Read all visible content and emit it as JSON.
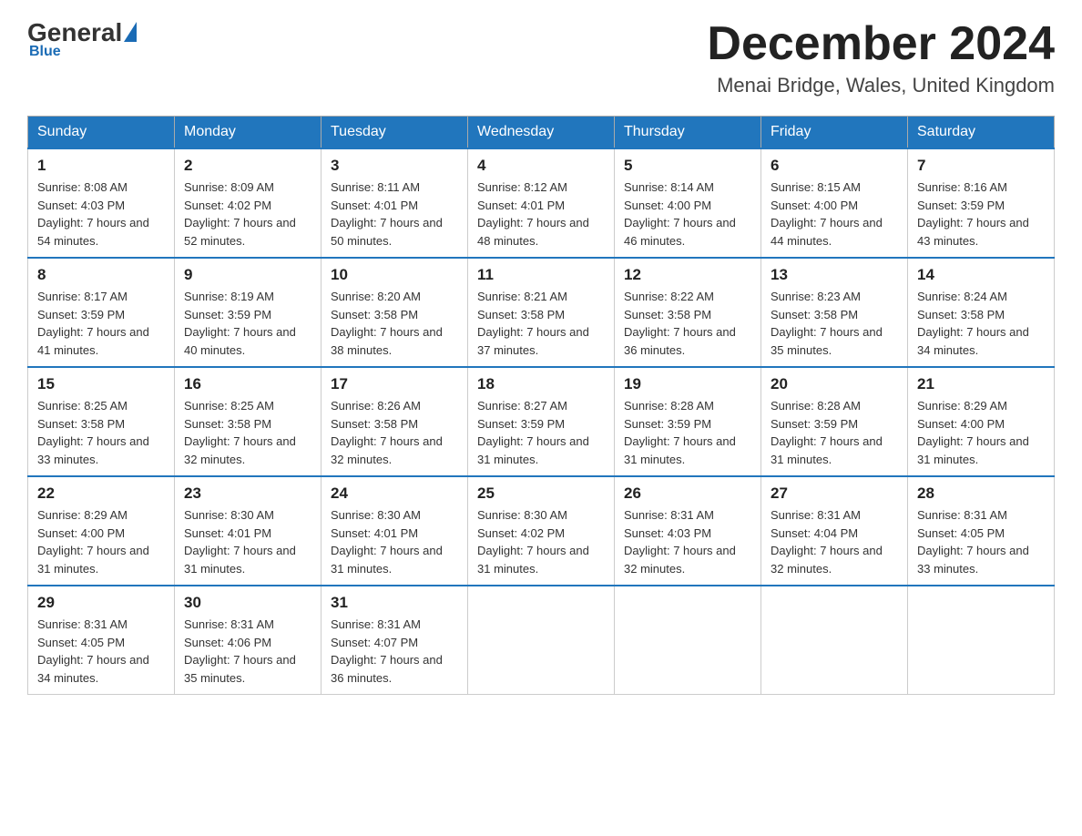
{
  "header": {
    "logo_general": "General",
    "logo_blue": "Blue",
    "month_title": "December 2024",
    "location": "Menai Bridge, Wales, United Kingdom"
  },
  "weekdays": [
    "Sunday",
    "Monday",
    "Tuesday",
    "Wednesday",
    "Thursday",
    "Friday",
    "Saturday"
  ],
  "weeks": [
    [
      {
        "day": "1",
        "sunrise": "8:08 AM",
        "sunset": "4:03 PM",
        "daylight": "7 hours and 54 minutes."
      },
      {
        "day": "2",
        "sunrise": "8:09 AM",
        "sunset": "4:02 PM",
        "daylight": "7 hours and 52 minutes."
      },
      {
        "day": "3",
        "sunrise": "8:11 AM",
        "sunset": "4:01 PM",
        "daylight": "7 hours and 50 minutes."
      },
      {
        "day": "4",
        "sunrise": "8:12 AM",
        "sunset": "4:01 PM",
        "daylight": "7 hours and 48 minutes."
      },
      {
        "day": "5",
        "sunrise": "8:14 AM",
        "sunset": "4:00 PM",
        "daylight": "7 hours and 46 minutes."
      },
      {
        "day": "6",
        "sunrise": "8:15 AM",
        "sunset": "4:00 PM",
        "daylight": "7 hours and 44 minutes."
      },
      {
        "day": "7",
        "sunrise": "8:16 AM",
        "sunset": "3:59 PM",
        "daylight": "7 hours and 43 minutes."
      }
    ],
    [
      {
        "day": "8",
        "sunrise": "8:17 AM",
        "sunset": "3:59 PM",
        "daylight": "7 hours and 41 minutes."
      },
      {
        "day": "9",
        "sunrise": "8:19 AM",
        "sunset": "3:59 PM",
        "daylight": "7 hours and 40 minutes."
      },
      {
        "day": "10",
        "sunrise": "8:20 AM",
        "sunset": "3:58 PM",
        "daylight": "7 hours and 38 minutes."
      },
      {
        "day": "11",
        "sunrise": "8:21 AM",
        "sunset": "3:58 PM",
        "daylight": "7 hours and 37 minutes."
      },
      {
        "day": "12",
        "sunrise": "8:22 AM",
        "sunset": "3:58 PM",
        "daylight": "7 hours and 36 minutes."
      },
      {
        "day": "13",
        "sunrise": "8:23 AM",
        "sunset": "3:58 PM",
        "daylight": "7 hours and 35 minutes."
      },
      {
        "day": "14",
        "sunrise": "8:24 AM",
        "sunset": "3:58 PM",
        "daylight": "7 hours and 34 minutes."
      }
    ],
    [
      {
        "day": "15",
        "sunrise": "8:25 AM",
        "sunset": "3:58 PM",
        "daylight": "7 hours and 33 minutes."
      },
      {
        "day": "16",
        "sunrise": "8:25 AM",
        "sunset": "3:58 PM",
        "daylight": "7 hours and 32 minutes."
      },
      {
        "day": "17",
        "sunrise": "8:26 AM",
        "sunset": "3:58 PM",
        "daylight": "7 hours and 32 minutes."
      },
      {
        "day": "18",
        "sunrise": "8:27 AM",
        "sunset": "3:59 PM",
        "daylight": "7 hours and 31 minutes."
      },
      {
        "day": "19",
        "sunrise": "8:28 AM",
        "sunset": "3:59 PM",
        "daylight": "7 hours and 31 minutes."
      },
      {
        "day": "20",
        "sunrise": "8:28 AM",
        "sunset": "3:59 PM",
        "daylight": "7 hours and 31 minutes."
      },
      {
        "day": "21",
        "sunrise": "8:29 AM",
        "sunset": "4:00 PM",
        "daylight": "7 hours and 31 minutes."
      }
    ],
    [
      {
        "day": "22",
        "sunrise": "8:29 AM",
        "sunset": "4:00 PM",
        "daylight": "7 hours and 31 minutes."
      },
      {
        "day": "23",
        "sunrise": "8:30 AM",
        "sunset": "4:01 PM",
        "daylight": "7 hours and 31 minutes."
      },
      {
        "day": "24",
        "sunrise": "8:30 AM",
        "sunset": "4:01 PM",
        "daylight": "7 hours and 31 minutes."
      },
      {
        "day": "25",
        "sunrise": "8:30 AM",
        "sunset": "4:02 PM",
        "daylight": "7 hours and 31 minutes."
      },
      {
        "day": "26",
        "sunrise": "8:31 AM",
        "sunset": "4:03 PM",
        "daylight": "7 hours and 32 minutes."
      },
      {
        "day": "27",
        "sunrise": "8:31 AM",
        "sunset": "4:04 PM",
        "daylight": "7 hours and 32 minutes."
      },
      {
        "day": "28",
        "sunrise": "8:31 AM",
        "sunset": "4:05 PM",
        "daylight": "7 hours and 33 minutes."
      }
    ],
    [
      {
        "day": "29",
        "sunrise": "8:31 AM",
        "sunset": "4:05 PM",
        "daylight": "7 hours and 34 minutes."
      },
      {
        "day": "30",
        "sunrise": "8:31 AM",
        "sunset": "4:06 PM",
        "daylight": "7 hours and 35 minutes."
      },
      {
        "day": "31",
        "sunrise": "8:31 AM",
        "sunset": "4:07 PM",
        "daylight": "7 hours and 36 minutes."
      },
      null,
      null,
      null,
      null
    ]
  ]
}
